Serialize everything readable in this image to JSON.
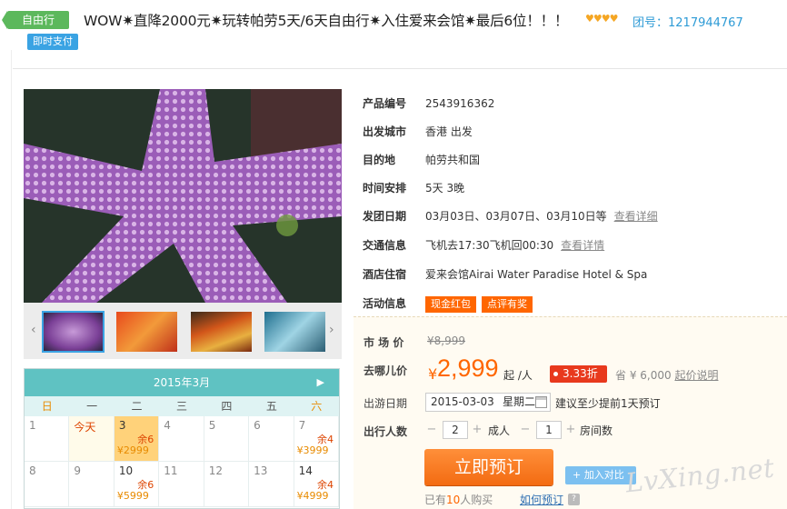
{
  "header": {
    "tag_type": "自由行",
    "tag_pay": "即时支付",
    "title": "WOW✷直降2000元✷玩转帕劳5天/6天自由行✷入住爱来会馆✷最后6位！！！",
    "stars": "♥♥♥♥",
    "group_no": "团号：1217944767"
  },
  "info": {
    "rows": [
      {
        "key": "产品编号",
        "value": "2543916362"
      },
      {
        "key": "出发城市",
        "value": "香港 出发"
      },
      {
        "key": "目的地",
        "value": "帕劳共和国"
      },
      {
        "key": "时间安排",
        "value": "5天 3晚"
      },
      {
        "key": "发团日期",
        "value": "03月03日、03月07日、03月10日等",
        "link": "查看详细"
      },
      {
        "key": "交通信息",
        "value": "飞机去17:30飞机回00:30",
        "link": "查看详情"
      },
      {
        "key": "酒店住宿",
        "value": "爱来会馆Airai Water Paradise Hotel & Spa"
      },
      {
        "key": "活动信息",
        "pills": [
          "现金红包",
          "点评有奖"
        ]
      }
    ]
  },
  "price": {
    "market_label": "市 场 价",
    "market_value": "¥8,999",
    "our_label": "去哪儿价",
    "yen": "¥",
    "our_value": "2,999",
    "per": "起 /人",
    "discount": "3.33折",
    "save": "省 ¥ 6,000",
    "save_link": "起价说明",
    "date_label": "出游日期",
    "date_value": "2015-03-03",
    "date_week": "星期二",
    "date_hint": "建议至少提前1天预订",
    "people_label": "出行人数",
    "adults": "2",
    "adults_unit": "成人",
    "rooms": "1",
    "rooms_unit": "房间数",
    "book_label": "立即预订",
    "compare_label": "+ 加入对比",
    "bought_prefix": "已有",
    "bought_count": "10",
    "bought_suffix": "人购买",
    "howto": "如何预订",
    "qmark": "?"
  },
  "gallery": {
    "prev": "‹",
    "next": "›"
  },
  "calendar": {
    "month": "2015年3月",
    "next": "▶",
    "weekdays": [
      "日",
      "一",
      "二",
      "三",
      "四",
      "五",
      "六"
    ],
    "cells": [
      {
        "d": "1"
      },
      {
        "d": "今天"
      },
      {
        "d": "3",
        "rem": "余6",
        "price": "¥2999"
      },
      {
        "d": "4"
      },
      {
        "d": "5"
      },
      {
        "d": "6"
      },
      {
        "d": "7",
        "rem": "余4",
        "price": "¥3999"
      },
      {
        "d": "8"
      },
      {
        "d": "9"
      },
      {
        "d": "10",
        "rem": "余6",
        "price": "¥5999"
      },
      {
        "d": "11"
      },
      {
        "d": "12"
      },
      {
        "d": "13"
      },
      {
        "d": "14",
        "rem": "余4",
        "price": "¥4999"
      }
    ]
  },
  "watermark": "LvXing.net"
}
